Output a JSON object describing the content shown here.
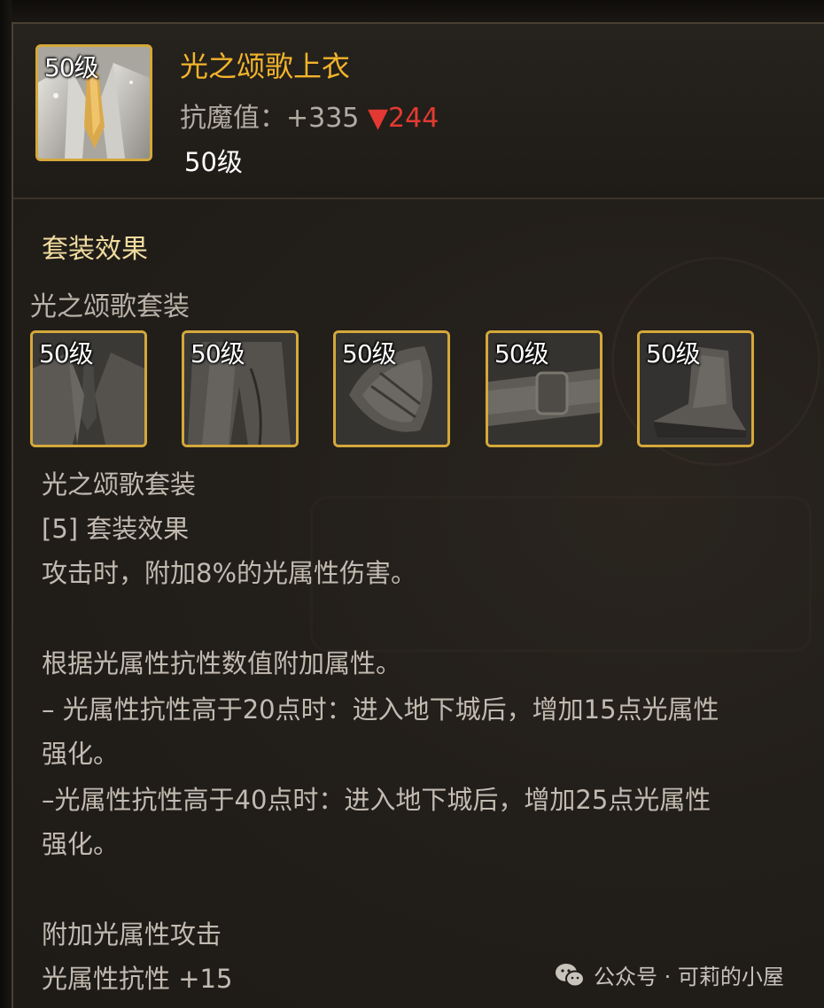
{
  "item": {
    "icon_level": "50级",
    "name": "光之颂歌上衣",
    "stat_label": "抗魔值：",
    "stat_value": "+335",
    "stat_diff": "▼244",
    "level": "50级"
  },
  "set_effect": {
    "title": "套装效果",
    "set_name": "光之颂歌套装",
    "pieces": [
      {
        "level": "50级",
        "icon": "jacket-icon"
      },
      {
        "level": "50级",
        "icon": "pants-icon"
      },
      {
        "level": "50级",
        "icon": "shoulder-icon"
      },
      {
        "level": "50级",
        "icon": "belt-icon"
      },
      {
        "level": "50级",
        "icon": "shoes-icon"
      }
    ],
    "lines": [
      "光之颂歌套装",
      "[5] 套装效果",
      "攻击时，附加8%的光属性伤害。",
      "根据光属性抗性数值附加属性。",
      "– 光属性抗性高于20点时：进入地下城后，增加15点光属性",
      "强化。",
      "–光属性抗性高于40点时：进入地下城后，增加25点光属性",
      "强化。",
      "附加光属性攻击",
      "光属性抗性 +15"
    ]
  },
  "watermark": "公众号 · 可莉的小屋",
  "colors": {
    "item_name": "#f2b42b",
    "stat_diff": "#e23a32",
    "section_title": "#f0dc9e",
    "icon_border": "#d4a83a"
  }
}
